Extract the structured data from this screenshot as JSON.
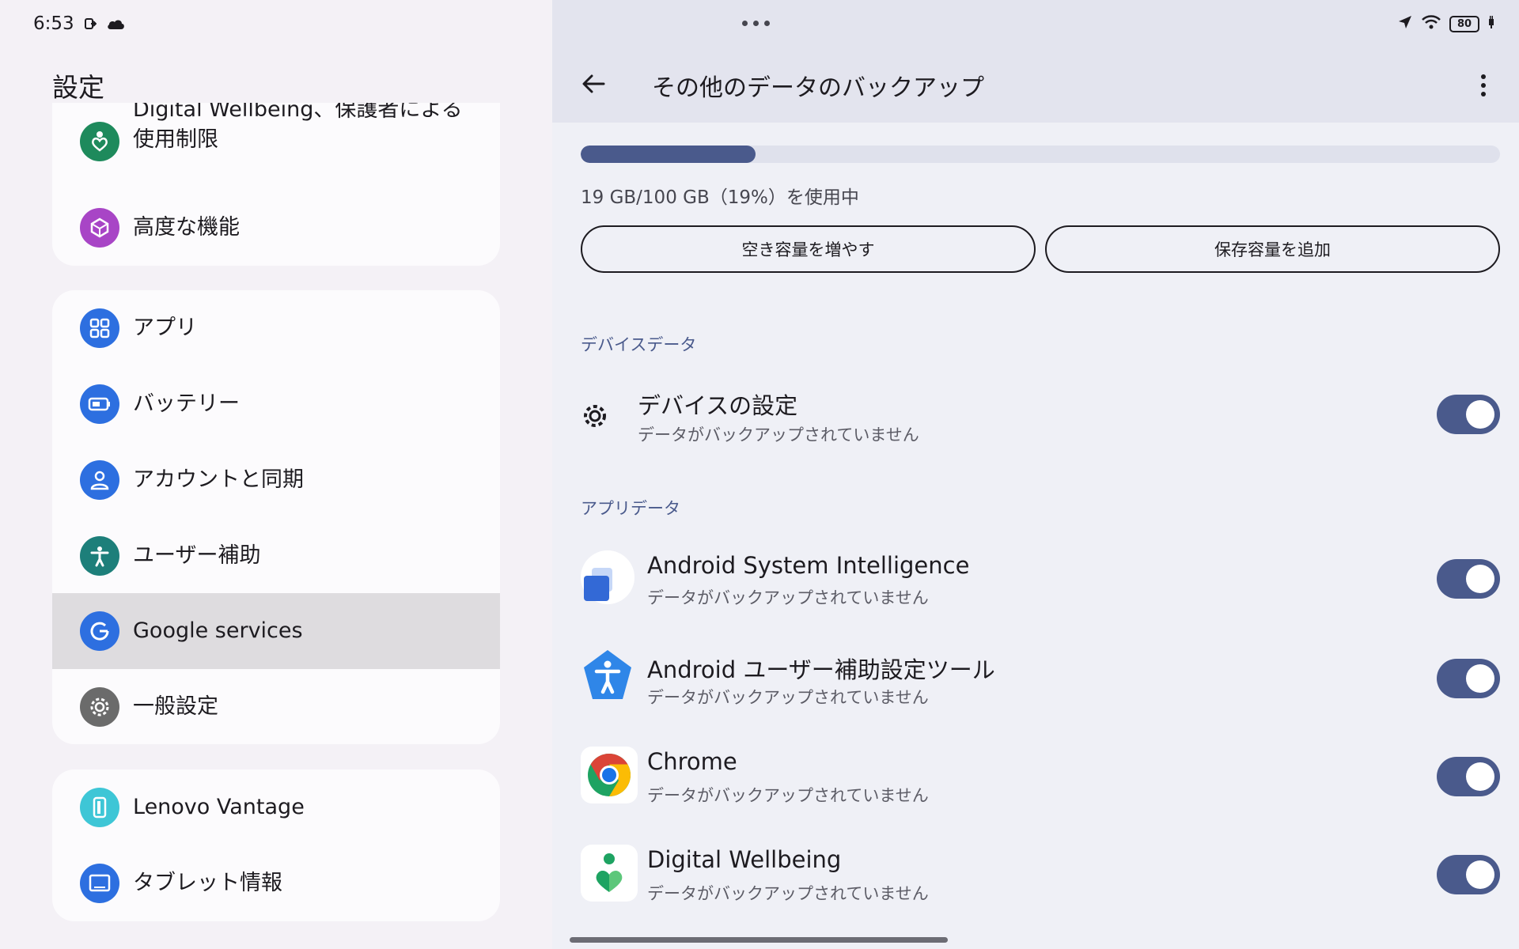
{
  "status_bar": {
    "time": "6:53",
    "battery_level": "80"
  },
  "left": {
    "title": "設定",
    "items": [
      {
        "label": "Digital Wellbeing、保護者による\n使用制限",
        "icon": "digital-wellbeing-icon",
        "color": "#1e8a5c"
      },
      {
        "label": "高度な機能",
        "icon": "advanced-features-icon",
        "color": "#a845c6"
      },
      {
        "label": "アプリ",
        "icon": "apps-icon",
        "color": "#2d6fe0"
      },
      {
        "label": "バッテリー",
        "icon": "battery-icon",
        "color": "#2d6fe0"
      },
      {
        "label": "アカウントと同期",
        "icon": "account-icon",
        "color": "#2d6fe0"
      },
      {
        "label": "ユーザー補助",
        "icon": "accessibility-icon",
        "color": "#1d7f7a"
      },
      {
        "label": "Google services",
        "icon": "google-icon",
        "color": "#2d6fe0",
        "selected": true
      },
      {
        "label": "一般設定",
        "icon": "gear-icon",
        "color": "#6b6b6b"
      },
      {
        "label": "Lenovo Vantage",
        "icon": "lenovo-vantage-icon",
        "color": "#3ec6d6"
      },
      {
        "label": "タブレット情報",
        "icon": "tablet-info-icon",
        "color": "#2d6fe0"
      }
    ]
  },
  "right": {
    "title": "その他のデータのバックアップ",
    "storage": {
      "used_fraction": 0.19,
      "usage_text": "19 GB/100 GB（19%）を使用中"
    },
    "buttons": {
      "free_up": "空き容量を増やす",
      "add_storage": "保存容量を追加"
    },
    "sections": {
      "device": "デバイスデータ",
      "apps": "アプリデータ"
    },
    "device_rows": [
      {
        "title": "デバイスの設定",
        "subtitle": "データがバックアップされていません",
        "enabled": true
      }
    ],
    "app_rows": [
      {
        "title": "Android System Intelligence",
        "subtitle": "データがバックアップされていません",
        "enabled": true
      },
      {
        "title": "Android ユーザー補助設定ツール",
        "subtitle": "データがバックアップされていません",
        "enabled": true
      },
      {
        "title": "Chrome",
        "subtitle": "データがバックアップされていません",
        "enabled": true
      },
      {
        "title": "Digital Wellbeing",
        "subtitle": "データがバックアップされていません",
        "enabled": true
      }
    ]
  },
  "colors": {
    "accent": "#4a5a8c",
    "left_bg": "#f4f1f6",
    "right_bg": "#eff0f6",
    "selected": "#dedcdf"
  }
}
